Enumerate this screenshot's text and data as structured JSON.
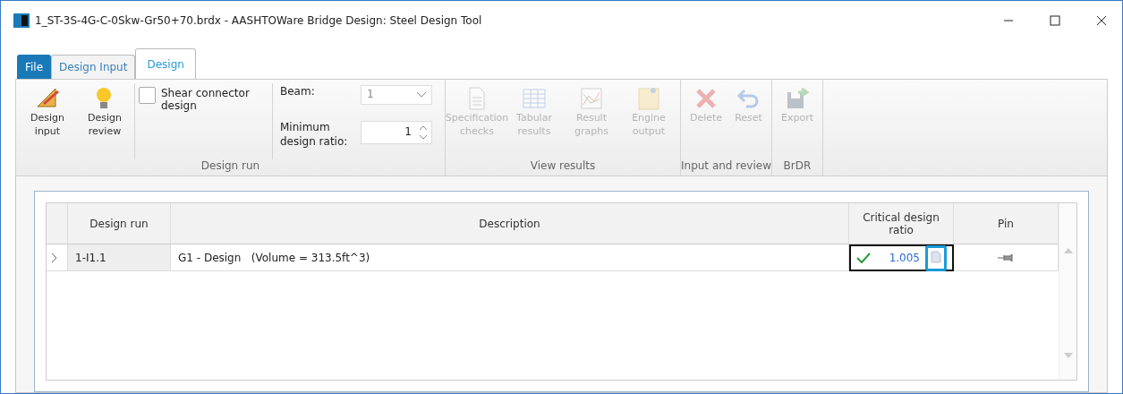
{
  "window": {
    "title": "1_ST-3S-4G-C-0Skw-Gr50+70.brdx - AASHTOWare Bridge Design: Steel Design Tool"
  },
  "tabs": [
    {
      "label": "File",
      "kind": "file",
      "selected": false
    },
    {
      "label": "Design Input",
      "kind": "tab",
      "selected": false
    },
    {
      "label": "Design",
      "kind": "tab",
      "selected": true
    }
  ],
  "ribbon": {
    "groups": [
      {
        "label": "Design run",
        "items": [
          {
            "kind": "button",
            "label": "Design input",
            "disabled": false
          },
          {
            "kind": "button",
            "label": "Design review",
            "disabled": false
          },
          {
            "kind": "checkbox",
            "label": "Shear connector design",
            "checked": false
          },
          {
            "kind": "fields",
            "beam_label": "Beam:",
            "beam_value": "1",
            "ratio_label": "Minimum design ratio:",
            "ratio_value": "1"
          }
        ]
      },
      {
        "label": "View results",
        "items": [
          {
            "kind": "button",
            "label": "Specification checks",
            "disabled": true
          },
          {
            "kind": "button",
            "label": "Tabular results",
            "disabled": true
          },
          {
            "kind": "button",
            "label": "Result graphs",
            "disabled": true
          },
          {
            "kind": "button",
            "label": "Engine output",
            "disabled": true
          }
        ]
      },
      {
        "label": "Input and review",
        "items": [
          {
            "kind": "button",
            "label": "Delete",
            "disabled": true
          },
          {
            "kind": "button",
            "label": "Reset",
            "disabled": true
          }
        ]
      },
      {
        "label": "BrDR",
        "items": [
          {
            "kind": "button",
            "label": "Export",
            "disabled": true
          }
        ]
      }
    ]
  },
  "table": {
    "columns": [
      "Design run",
      "Description",
      "Critical design ratio",
      "Pin"
    ],
    "rows": [
      {
        "run": "1-I1.1",
        "description": "G1 - Design   (Volume = 313.5ft^3)",
        "ratio": "1.005",
        "passed": true,
        "ratio_focused": true
      }
    ]
  }
}
